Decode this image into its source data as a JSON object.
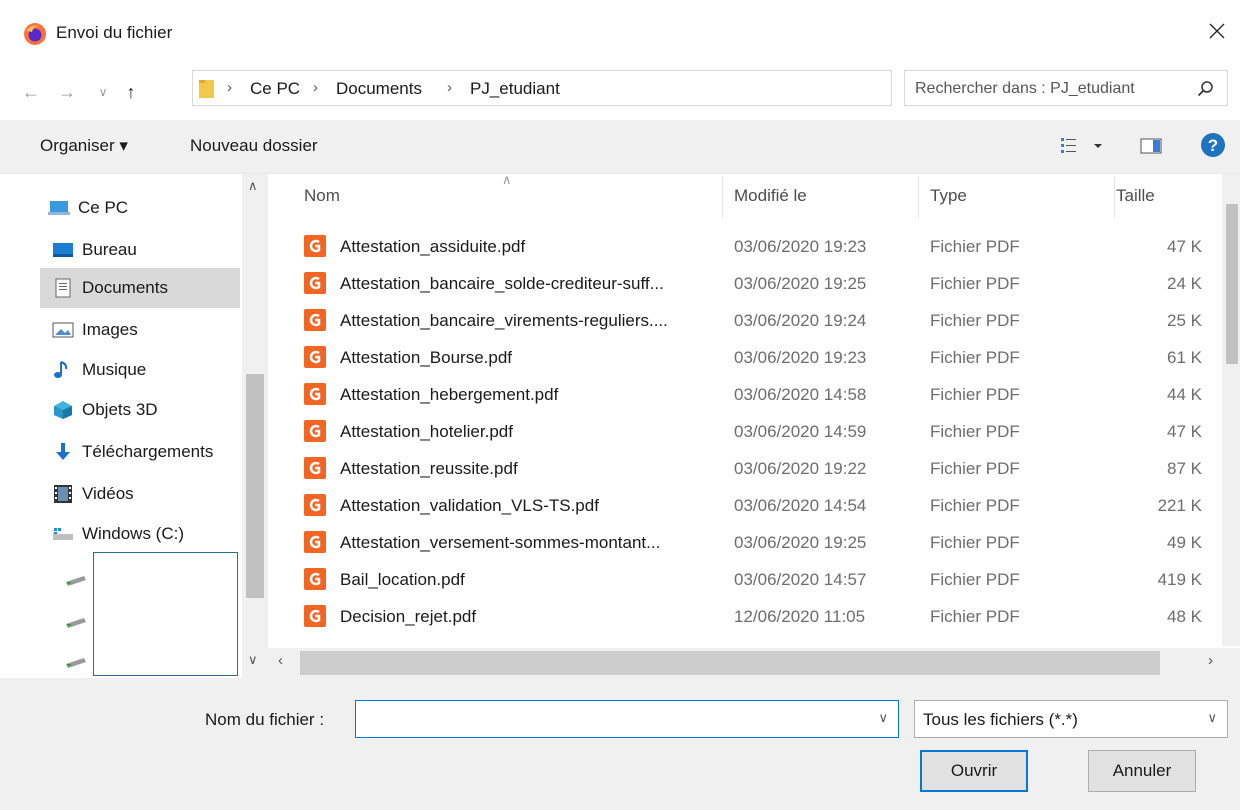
{
  "window": {
    "title": "Envoi du fichier"
  },
  "address": {
    "crumbs": [
      "Ce PC",
      "Documents",
      "PJ_etudiant"
    ],
    "search_placeholder": "Rechercher dans : PJ_etudiant"
  },
  "toolbar": {
    "organize_label": "Organiser ▾",
    "new_folder_label": "Nouveau dossier"
  },
  "nav": {
    "items": [
      {
        "label": "Ce PC",
        "icon": "pc-icon"
      },
      {
        "label": "Bureau",
        "icon": "desktop-icon"
      },
      {
        "label": "Documents",
        "icon": "documents-icon",
        "selected": true
      },
      {
        "label": "Images",
        "icon": "images-icon"
      },
      {
        "label": "Musique",
        "icon": "music-icon"
      },
      {
        "label": "Objets 3D",
        "icon": "objects-3d-icon"
      },
      {
        "label": "Téléchargements",
        "icon": "downloads-icon"
      },
      {
        "label": "Vidéos",
        "icon": "videos-icon"
      },
      {
        "label": "Windows (C:)",
        "icon": "drive-icon"
      }
    ]
  },
  "columns": {
    "name": "Nom",
    "modified": "Modifié le",
    "type": "Type",
    "size": "Taille"
  },
  "files": [
    {
      "name": "Attestation_assiduite.pdf",
      "date": "03/06/2020 19:23",
      "type": "Fichier PDF",
      "size": "47 K"
    },
    {
      "name": "Attestation_bancaire_solde-crediteur-suff...",
      "date": "03/06/2020 19:25",
      "type": "Fichier PDF",
      "size": "24 K"
    },
    {
      "name": "Attestation_bancaire_virements-reguliers....",
      "date": "03/06/2020 19:24",
      "type": "Fichier PDF",
      "size": "25 K"
    },
    {
      "name": "Attestation_Bourse.pdf",
      "date": "03/06/2020 19:23",
      "type": "Fichier PDF",
      "size": "61 K"
    },
    {
      "name": "Attestation_hebergement.pdf",
      "date": "03/06/2020 14:58",
      "type": "Fichier PDF",
      "size": "44 K"
    },
    {
      "name": "Attestation_hotelier.pdf",
      "date": "03/06/2020 14:59",
      "type": "Fichier PDF",
      "size": "47 K"
    },
    {
      "name": "Attestation_reussite.pdf",
      "date": "03/06/2020 19:22",
      "type": "Fichier PDF",
      "size": "87 K"
    },
    {
      "name": "Attestation_validation_VLS-TS.pdf",
      "date": "03/06/2020 14:54",
      "type": "Fichier PDF",
      "size": "221 K"
    },
    {
      "name": "Attestation_versement-sommes-montant...",
      "date": "03/06/2020 19:25",
      "type": "Fichier PDF",
      "size": "49 K"
    },
    {
      "name": "Bail_location.pdf",
      "date": "03/06/2020 14:57",
      "type": "Fichier PDF",
      "size": "419 K"
    },
    {
      "name": "Decision_rejet.pdf",
      "date": "12/06/2020 11:05",
      "type": "Fichier PDF",
      "size": "48 K"
    }
  ],
  "bottom": {
    "filename_label": "Nom du fichier :",
    "filename_value": "",
    "filter_value": "Tous les fichiers (*.*)",
    "open_label": "Ouvrir",
    "cancel_label": "Annuler"
  },
  "colors": {
    "accent": "#0078d7",
    "pdf_icon": "#f26522",
    "help": "#1e73be"
  }
}
